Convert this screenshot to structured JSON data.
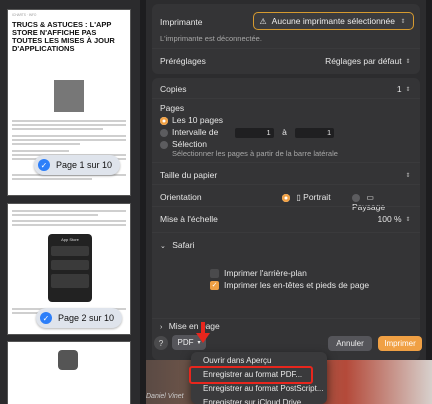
{
  "preview": {
    "page1": {
      "site": "ICHARTS · INFO",
      "title": "TRUCS & ASTUCES : L'APP STORE N'AFFICHE PAS TOUTES LES MISES À JOUR D'APPLICATIONS",
      "indicator": "Page 1 sur 10"
    },
    "page2": {
      "app_store_header": "App Store",
      "indicator": "Page 2 sur 10"
    }
  },
  "printer": {
    "label": "Imprimante",
    "value": "Aucune imprimante sélectionnée",
    "status": "L'imprimante est déconnectée."
  },
  "presets": {
    "label": "Préréglages",
    "value": "Réglages par défaut"
  },
  "copies": {
    "label": "Copies",
    "value": "1"
  },
  "pages": {
    "label": "Pages",
    "all_label": "Les 10 pages",
    "range_label": "Intervalle de",
    "range_from": "1",
    "range_to_label": "à",
    "range_to": "1",
    "selection_label": "Sélection",
    "selection_hint": "Sélectionner les pages à partir de la barre latérale"
  },
  "paper_size": {
    "label": "Taille du papier"
  },
  "orientation": {
    "label": "Orientation",
    "portrait": "Portrait",
    "landscape": "Paysage"
  },
  "scale": {
    "label": "Mise à l'échelle",
    "value": "100 %"
  },
  "safari": {
    "label": "Safari",
    "print_bg_label": "Imprimer l'arrière-plan",
    "headers_label": "Imprimer les en-têtes et pieds de page"
  },
  "layout": {
    "label": "Mise en page"
  },
  "footer": {
    "help": "?",
    "pdf": "PDF",
    "cancel": "Annuler",
    "print": "Imprimer"
  },
  "pdf_menu": {
    "items": [
      "Ouvrir dans Aperçu",
      "Enregistrer au format PDF...",
      "Enregistrer au format PostScript...",
      "Enregistrer sur iCloud Drive"
    ]
  },
  "caption": "Daniel Vinet",
  "colors": {
    "accent": "#f0a044",
    "warning": "#d69a2f",
    "highlight": "#e8261d"
  }
}
